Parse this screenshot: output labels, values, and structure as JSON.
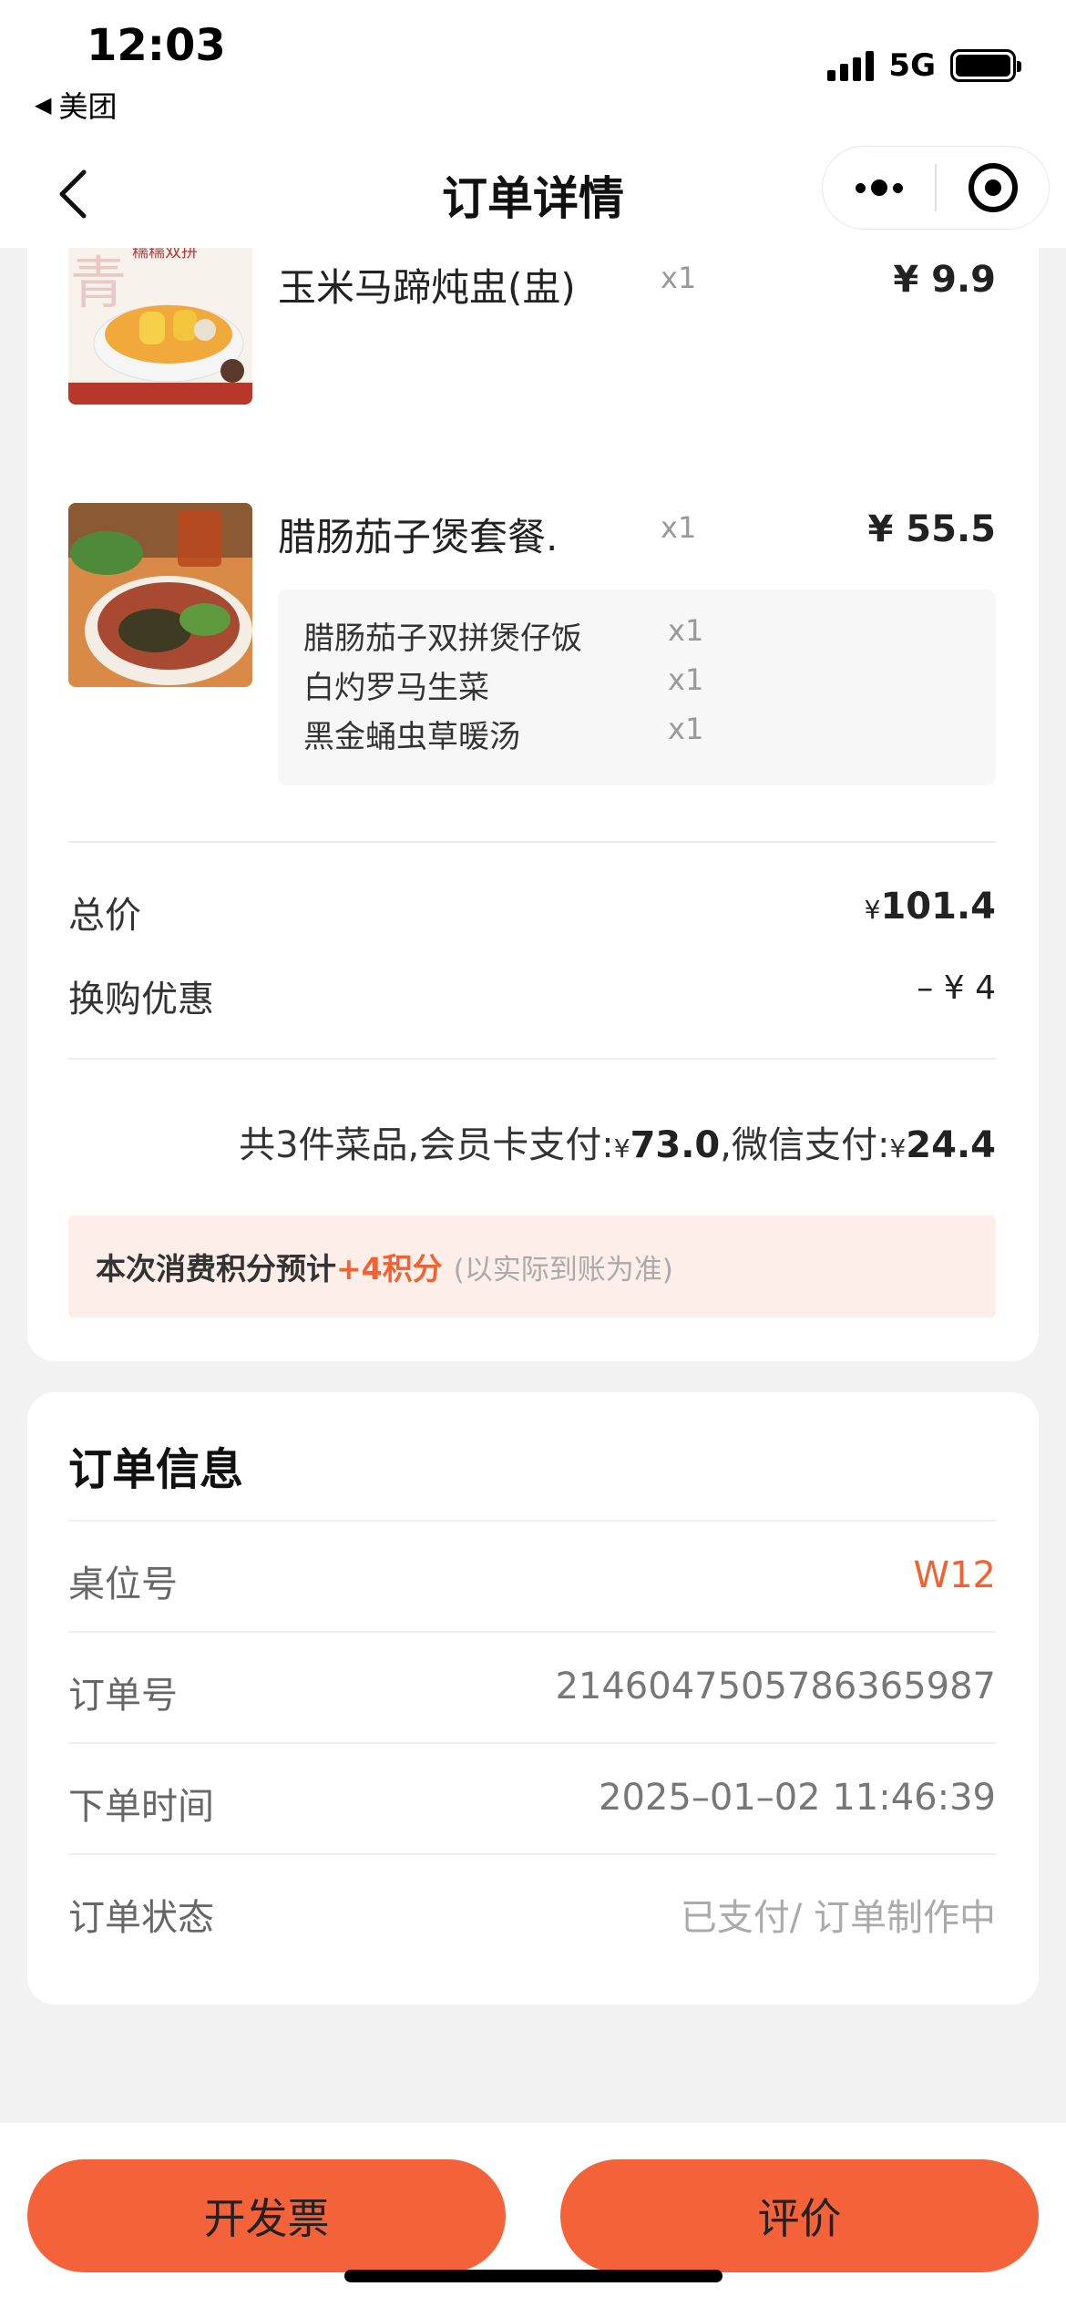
{
  "status_bar": {
    "time": "12:03",
    "back_app": "美团",
    "network": "5G"
  },
  "nav": {
    "title": "订单详情"
  },
  "items": [
    {
      "name": "玉米马蹄炖盅(盅)",
      "qty": "x1",
      "price": "¥ 9.9",
      "image": "corn-soup-image"
    },
    {
      "name": "腊肠茄子煲套餐.",
      "qty": "x1",
      "price": "¥ 55.5",
      "image": "clay-pot-set-image",
      "sub_items": [
        {
          "name": "腊肠茄子双拼煲仔饭",
          "qty": "x1"
        },
        {
          "name": "白灼罗马生菜",
          "qty": "x1"
        },
        {
          "name": "黑金蛹虫草暖汤",
          "qty": "x1"
        }
      ]
    }
  ],
  "summary": {
    "total_label": "总价",
    "total_yen": "¥",
    "total_value": "101.4",
    "discount_label": "换购优惠",
    "discount_value": "– ¥ 4"
  },
  "payment": {
    "prefix": "共3件菜品,会员卡支付:",
    "member_yen": "¥",
    "member_amount": "73.0",
    "wechat_label": ",微信支付:",
    "wechat_yen": "¥",
    "wechat_amount": "24.4"
  },
  "points": {
    "lead": "本次消费积分预计",
    "points": "+4积分",
    "note": "(以实际到账为准)"
  },
  "order_info": {
    "title": "订单信息",
    "rows": [
      {
        "label": "桌位号",
        "value": "W12"
      },
      {
        "label": "订单号",
        "value": "2146047505786365987"
      },
      {
        "label": "下单时间",
        "value": "2025–01–02 11:46:39"
      },
      {
        "label": "订单状态",
        "value": "已支付/ 订单制作中"
      }
    ]
  },
  "actions": {
    "invoice": "开发票",
    "review": "评价"
  },
  "colors": {
    "accent": "#f4623a",
    "points_bg": "#fdeeea",
    "page_bg": "#f2f2f2"
  }
}
